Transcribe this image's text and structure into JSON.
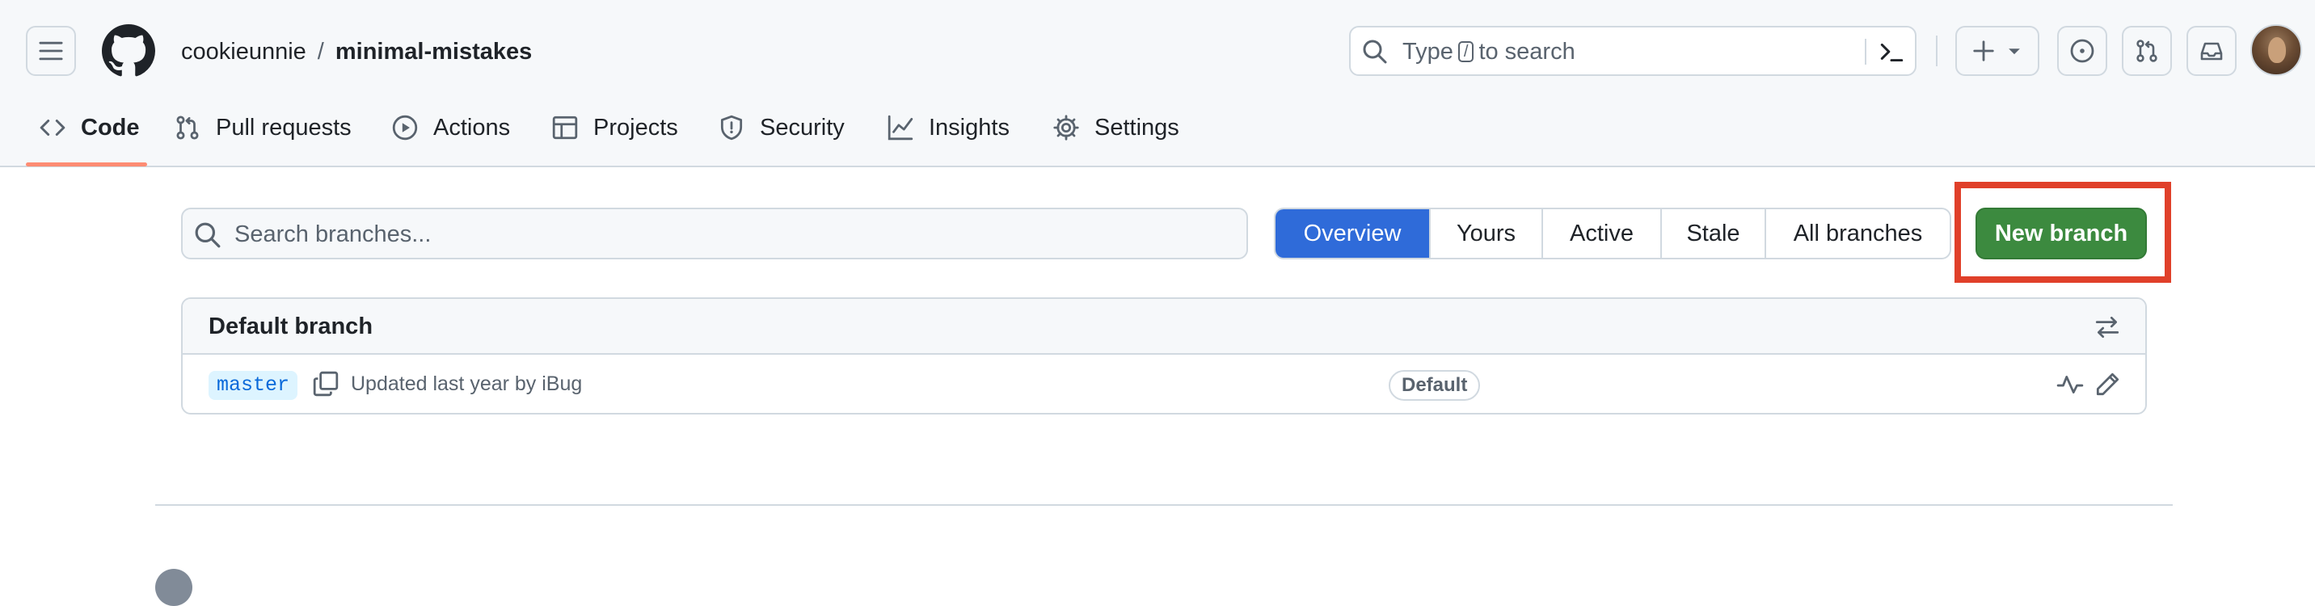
{
  "header": {
    "owner": "cookieunnie",
    "separator": "/",
    "repo": "minimal-mistakes",
    "search": {
      "prefix": "Type",
      "key": "/",
      "suffix": "to search"
    }
  },
  "nav": {
    "tabs": [
      {
        "label": "Code",
        "icon": "code-icon",
        "selected": true
      },
      {
        "label": "Pull requests",
        "icon": "git-pull-request-icon"
      },
      {
        "label": "Actions",
        "icon": "play-icon"
      },
      {
        "label": "Projects",
        "icon": "table-icon"
      },
      {
        "label": "Security",
        "icon": "shield-icon"
      },
      {
        "label": "Insights",
        "icon": "graph-icon"
      },
      {
        "label": "Settings",
        "icon": "gear-icon"
      }
    ]
  },
  "branches": {
    "search_placeholder": "Search branches...",
    "filters": [
      {
        "label": "Overview",
        "active": true
      },
      {
        "label": "Yours"
      },
      {
        "label": "Active"
      },
      {
        "label": "Stale"
      },
      {
        "label": "All branches"
      }
    ],
    "new_branch_label": "New branch",
    "default_section": {
      "title": "Default branch",
      "rows": [
        {
          "name": "master",
          "updated": "Updated last year by iBug",
          "badge": "Default"
        }
      ]
    }
  },
  "colors": {
    "accent_blue": "#2f6bd9",
    "primary_green": "#3c8a3f",
    "highlight_red": "#e0402a",
    "tab_underline": "#fd8c73",
    "branch_label_bg": "#ddf4ff",
    "branch_label_text": "#0969da"
  }
}
